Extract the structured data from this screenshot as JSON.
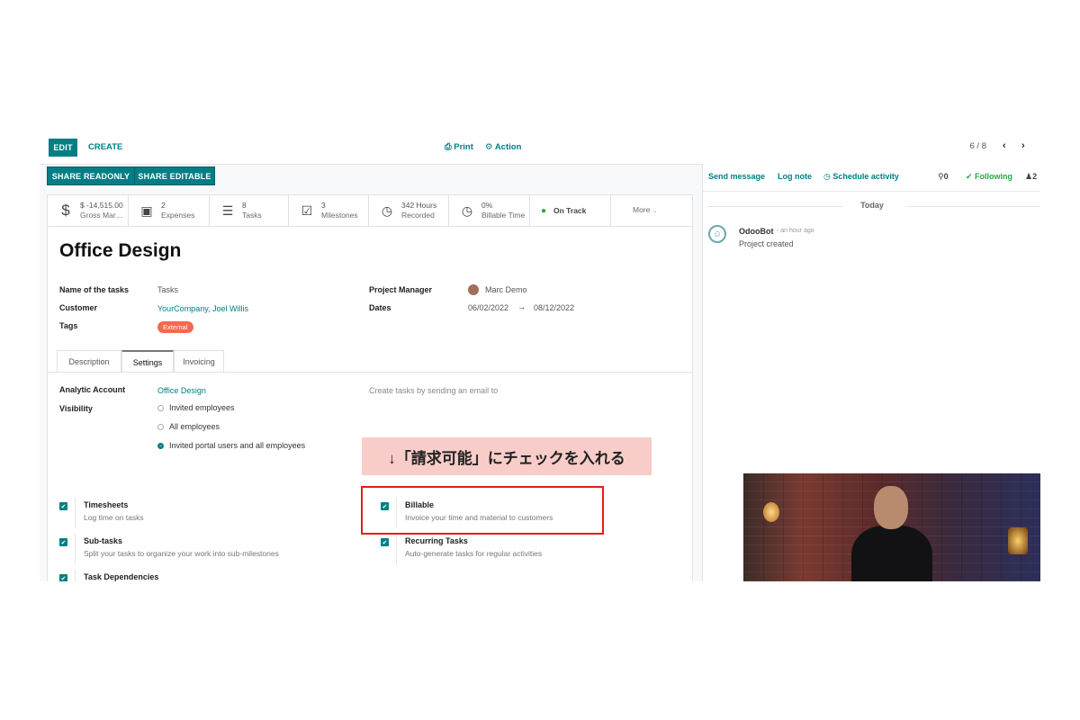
{
  "toolbar": {
    "edit_label": "EDIT",
    "create_label": "CREATE",
    "print_label": "Print",
    "action_label": "Action",
    "pager": "6 / 8",
    "share_readonly_label": "SHARE READONLY",
    "share_editable_label": "SHARE EDITABLE"
  },
  "stats": [
    {
      "icon": "dollar-icon",
      "glyph": "$",
      "top": "$ -14,515.00",
      "bottom": "Gross Mar…"
    },
    {
      "icon": "money-bill-icon",
      "glyph": "▣",
      "top": "2",
      "bottom": "Expenses"
    },
    {
      "icon": "tasks-list-icon",
      "glyph": "☰",
      "top": "8",
      "bottom": "Tasks"
    },
    {
      "icon": "checkbox-icon",
      "glyph": "☑",
      "top": "3",
      "bottom": "Milestones"
    },
    {
      "icon": "clock-icon",
      "glyph": "◷",
      "top": "342 Hours",
      "bottom": "Recorded"
    },
    {
      "icon": "clock-icon",
      "glyph": "◷",
      "top": "0%",
      "bottom": "Billable Time"
    },
    {
      "icon": "status-dot-icon",
      "glyph": "●",
      "top": "On Track",
      "bottom": ""
    },
    {
      "icon": "chevron-down-icon",
      "glyph": "",
      "top": "More",
      "bottom": ""
    }
  ],
  "project": {
    "title": "Office Design",
    "name_of_tasks_label": "Name of the tasks",
    "name_of_tasks_value": "Tasks",
    "customer_label": "Customer",
    "customer_value": "YourCompany, Joel Willis",
    "tags_label": "Tags",
    "tag_value": "External",
    "manager_label": "Project Manager",
    "manager_value": "Marc Demo",
    "dates_label": "Dates",
    "date_start": "06/02/2022",
    "date_end": "08/12/2022"
  },
  "tabs": [
    "Description",
    "Settings",
    "Invoicing"
  ],
  "settings": {
    "analytic_label": "Analytic Account",
    "analytic_value": "Office Design",
    "visibility_label": "Visibility",
    "visibility_options": [
      "Invited employees",
      "All employees",
      "Invited portal users and all employees"
    ],
    "visibility_selected": "Invited portal users and all employees",
    "email_hint": "Create tasks by sending an email to",
    "options": [
      {
        "title": "Timesheets",
        "desc": "Log time on tasks",
        "checked": true
      },
      {
        "title": "Billable",
        "desc": "Invoice your time and material to customers",
        "checked": true
      },
      {
        "title": "Sub-tasks",
        "desc": "Split your tasks to organize your work into sub-milestones",
        "checked": true
      },
      {
        "title": "Recurring Tasks",
        "desc": "Auto-generate tasks for regular activities",
        "checked": true
      },
      {
        "title": "Task Dependencies",
        "desc": "",
        "checked": true
      }
    ]
  },
  "chatter": {
    "send_message": "Send message",
    "log_note": "Log note",
    "schedule_activity": "Schedule activity",
    "attachments": "0",
    "following": "Following",
    "followers": "2",
    "date_separator": "Today",
    "message_author": "OdooBot",
    "message_time": "- an hour ago",
    "message_body": "Project created"
  },
  "overlay": {
    "caption": "↓「請求可能」にチェックを入れる"
  },
  "colors": {
    "brand": "#017e84",
    "tag": "#f4694e",
    "highlight_box": "#e0201c",
    "caption_bg": "#f8cdc9",
    "status_green": "#28a745"
  }
}
